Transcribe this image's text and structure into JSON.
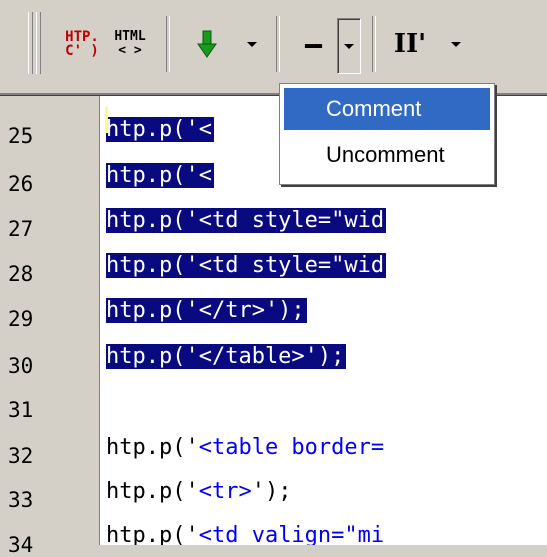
{
  "toolbar": {
    "htp_icon_top": "HTP.",
    "htp_icon_bottom": "C' )",
    "html_icon_top": "HTML",
    "html_icon_bottom": "< >",
    "dash_icon": "--",
    "pause_icon": "II'"
  },
  "menu": {
    "items": [
      {
        "label": "Comment",
        "highlighted": true
      },
      {
        "label": "Uncomment",
        "highlighted": false
      }
    ]
  },
  "editor": {
    "line_numbers": [
      "25",
      "26",
      "27",
      "28",
      "29",
      "30",
      "31",
      "32",
      "33",
      "34"
    ],
    "lines": [
      {
        "text": "htp.p('<",
        "selected": true
      },
      {
        "text": "htp.p('<",
        "selected": true
      },
      {
        "text": "htp.p('<td style=\"wid",
        "selected": true
      },
      {
        "text": "htp.p('<td style=\"wid",
        "selected": true
      },
      {
        "text": "htp.p('</tr>');",
        "selected": true
      },
      {
        "text": "htp.p('</table>');",
        "selected": true
      },
      {
        "text": "",
        "selected": false
      },
      {
        "pre": "htp.p('",
        "str": "<table border=",
        "post": "",
        "selected": false
      },
      {
        "pre": "htp.p('",
        "str": "<tr>",
        "post": "');",
        "selected": false
      },
      {
        "pre": "htp.p('",
        "str": "<td valign=\"mi",
        "post": "",
        "selected": false
      }
    ]
  },
  "colors": {
    "selection": "#0a0a80",
    "menu_highlight": "#316ac5",
    "string_literal": "#0000ff",
    "gutter_bg": "#d4d0c8"
  }
}
